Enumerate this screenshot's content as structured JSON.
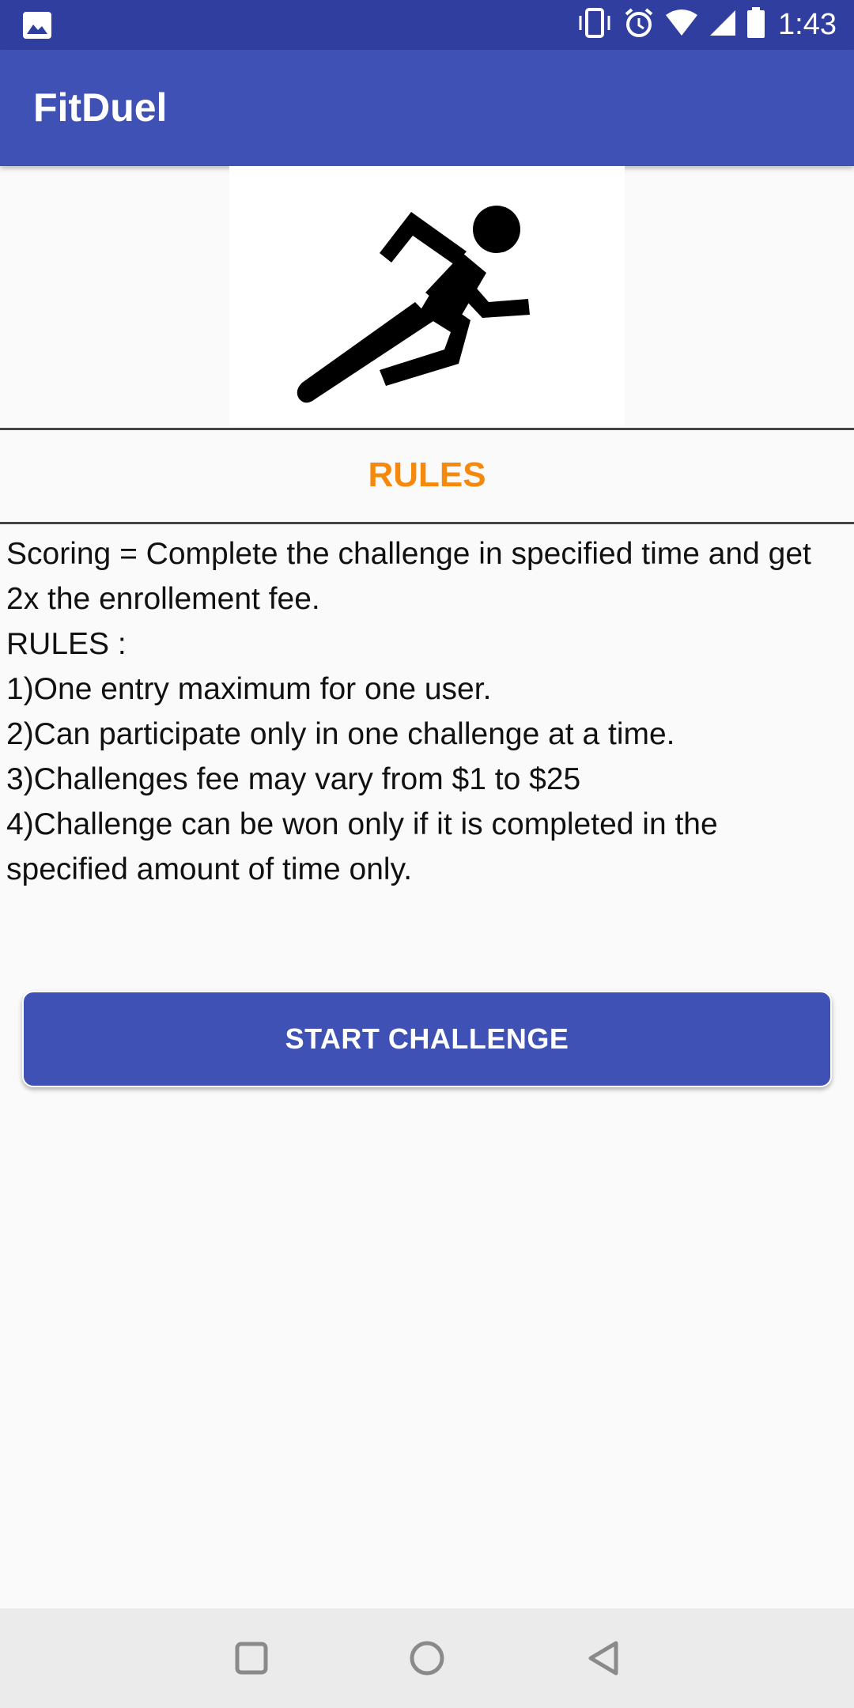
{
  "status_bar": {
    "time": "1:43",
    "icons": [
      "image-notification-icon",
      "vibrate-icon",
      "alarm-icon",
      "wifi-icon",
      "signal-icon",
      "battery-icon"
    ]
  },
  "app_bar": {
    "title": "FitDuel"
  },
  "hero": {
    "icon": "running-person-icon"
  },
  "rules": {
    "heading": "RULES",
    "lines": [
      "Scoring = Complete the challenge in specified time and get 2x the enrollement fee.",
      "RULES :",
      "1)One entry maximum for one user.",
      "2)Can participate only in one challenge at a time.",
      "3)Challenges fee may vary from $1 to $25",
      "4)Challenge can be won only if it is completed in the specified amount of time only."
    ]
  },
  "start_button": {
    "label": "START CHALLENGE"
  },
  "nav_bar": {
    "icons": [
      "recents-icon",
      "home-icon",
      "back-icon"
    ]
  },
  "colors": {
    "status_bar": "#303f9f",
    "app_bar": "#3f51b5",
    "accent": "#f5890c",
    "button": "#3f51b5",
    "background": "#fafafa"
  }
}
